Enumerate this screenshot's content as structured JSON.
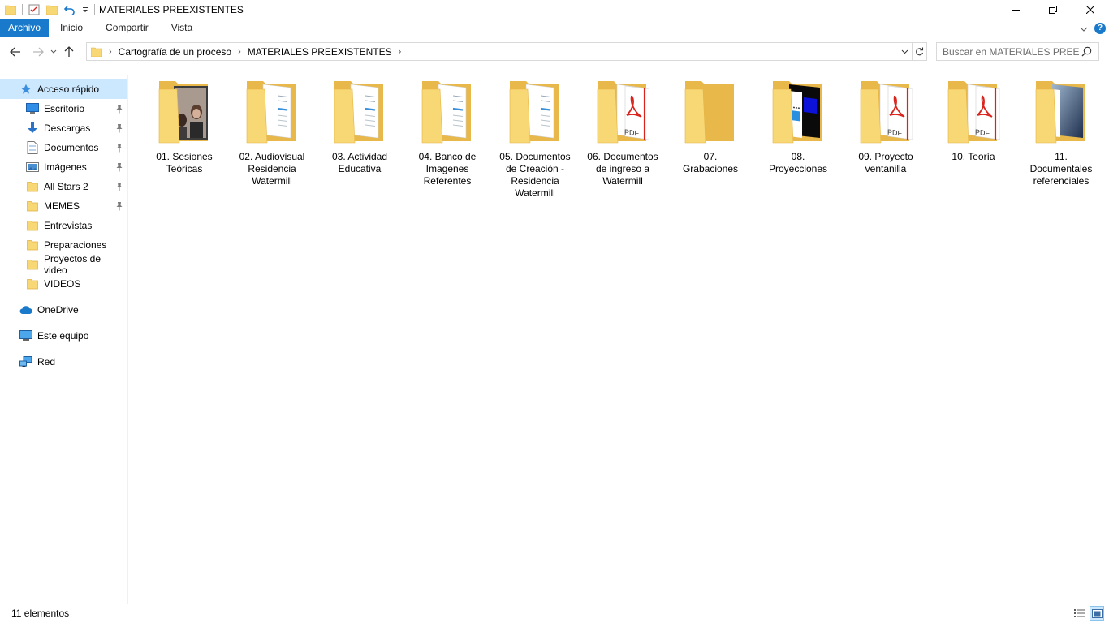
{
  "window": {
    "title": "MATERIALES PREEXISTENTES",
    "controls": {
      "minimize": "—",
      "maximize": "❐",
      "close": "✕"
    }
  },
  "ribbon": {
    "tabs": [
      {
        "label": "Archivo",
        "active": true
      },
      {
        "label": "Inicio",
        "active": false
      },
      {
        "label": "Compartir",
        "active": false
      },
      {
        "label": "Vista",
        "active": false
      }
    ],
    "help": "?"
  },
  "address": {
    "breadcrumbs": [
      "Cartografía de un proceso",
      "MATERIALES PREEXISTENTES"
    ]
  },
  "search": {
    "placeholder": "Buscar en MATERIALES PREEX..."
  },
  "sidebar": {
    "items": [
      {
        "label": "Acceso rápido",
        "icon": "star-icon",
        "selected": true,
        "pinned": false,
        "indent": 1
      },
      {
        "label": "Escritorio",
        "icon": "desktop-icon",
        "selected": false,
        "pinned": true,
        "indent": 2
      },
      {
        "label": "Descargas",
        "icon": "download-icon",
        "selected": false,
        "pinned": true,
        "indent": 2
      },
      {
        "label": "Documentos",
        "icon": "documents-icon",
        "selected": false,
        "pinned": true,
        "indent": 2
      },
      {
        "label": "Imágenes",
        "icon": "pictures-icon",
        "selected": false,
        "pinned": true,
        "indent": 2
      },
      {
        "label": "All Stars 2",
        "icon": "folder-icon",
        "selected": false,
        "pinned": true,
        "indent": 2
      },
      {
        "label": "MEMES",
        "icon": "folder-icon",
        "selected": false,
        "pinned": true,
        "indent": 2
      },
      {
        "label": "Entrevistas",
        "icon": "folder-icon",
        "selected": false,
        "pinned": false,
        "indent": 2
      },
      {
        "label": "Preparaciones",
        "icon": "folder-icon",
        "selected": false,
        "pinned": false,
        "indent": 2
      },
      {
        "label": "Proyectos de video",
        "icon": "folder-icon",
        "selected": false,
        "pinned": false,
        "indent": 2
      },
      {
        "label": "VIDEOS",
        "icon": "folder-icon",
        "selected": false,
        "pinned": false,
        "indent": 2
      },
      {
        "label": "OneDrive",
        "icon": "cloud-icon",
        "selected": false,
        "pinned": false,
        "indent": 1,
        "gap": true
      },
      {
        "label": "Este equipo",
        "icon": "computer-icon",
        "selected": false,
        "pinned": false,
        "indent": 1,
        "gap": true
      },
      {
        "label": "Red",
        "icon": "network-icon",
        "selected": false,
        "pinned": false,
        "indent": 1,
        "gap": true
      }
    ]
  },
  "folders": [
    {
      "label": "01. Sesiones Teóricas",
      "preview": "photo"
    },
    {
      "label": "02. Audiovisual Residencia Watermill",
      "preview": "doc"
    },
    {
      "label": "03. Actividad Educativa",
      "preview": "doc"
    },
    {
      "label": "04. Banco de Imagenes Referentes",
      "preview": "doc"
    },
    {
      "label": "05. Documentos de Creación - Residencia Watermill",
      "preview": "doc"
    },
    {
      "label": "06. Documentos de ingreso a Watermill",
      "preview": "pdf"
    },
    {
      "label": "07. Grabaciones",
      "preview": "empty"
    },
    {
      "label": "08. Proyecciones",
      "preview": "video"
    },
    {
      "label": "09. Proyecto ventanilla",
      "preview": "pdf"
    },
    {
      "label": "10. Teoría",
      "preview": "pdf"
    },
    {
      "label": "11. Documentales referenciales",
      "preview": "gradient"
    }
  ],
  "status": {
    "count": "11 elementos"
  },
  "colors": {
    "accent": "#1979ca",
    "selection": "#cce8ff",
    "folder": "#f8d775",
    "folder_dark": "#e8b84a",
    "pdf_red": "#d9231d"
  }
}
